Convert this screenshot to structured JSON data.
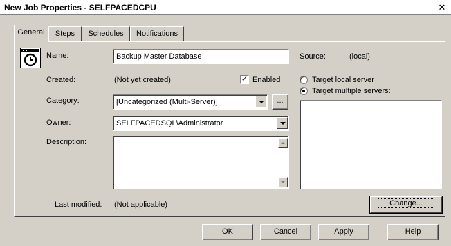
{
  "window": {
    "title": "New Job Properties - SELFPACEDCPU",
    "close_glyph": "✕"
  },
  "tabs": [
    {
      "label": "General"
    },
    {
      "label": "Steps"
    },
    {
      "label": "Schedules"
    },
    {
      "label": "Notifications"
    }
  ],
  "general": {
    "name_label": "Name:",
    "name_value": "Backup Master Database",
    "source_label": "Source:",
    "source_value": "(local)",
    "created_label": "Created:",
    "created_value": "(Not yet created)",
    "enabled_label": "Enabled",
    "enabled_checked": true,
    "category_label": "Category:",
    "category_value": "[Uncategorized (Multi-Server)]",
    "category_browse_label": "...",
    "owner_label": "Owner:",
    "owner_value": "SELFPACEDSQL\\Administrator",
    "description_label": "Description:",
    "description_value": "",
    "target_local_label": "Target local server",
    "target_multiple_label": "Target multiple servers:",
    "target_selected": "multiple",
    "last_modified_label": "Last modified:",
    "last_modified_value": "(Not applicable)",
    "change_button": "Change..."
  },
  "footer": {
    "ok": "OK",
    "cancel": "Cancel",
    "apply": "Apply",
    "help": "Help"
  },
  "icons": {
    "job_icon": "clock-icon"
  }
}
